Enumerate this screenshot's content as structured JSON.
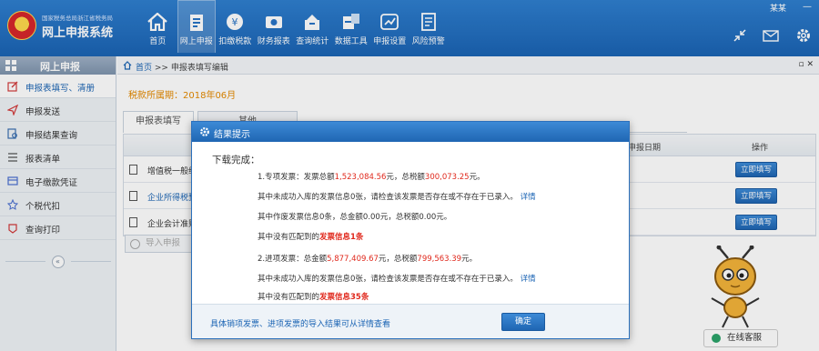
{
  "header": {
    "org_name": "国家税务总局浙江省税务局",
    "system_name": "网上申报系统",
    "user": "某某",
    "nav": [
      {
        "label": "首页",
        "icon": "home-icon"
      },
      {
        "label": "网上申报",
        "icon": "declare-icon"
      },
      {
        "label": "扣缴税款",
        "icon": "tax-payment-icon"
      },
      {
        "label": "财务报表",
        "icon": "report-icon"
      },
      {
        "label": "查询统计",
        "icon": "query-icon"
      },
      {
        "label": "数据工具",
        "icon": "tools-icon"
      },
      {
        "label": "申报设置",
        "icon": "settings-icon"
      },
      {
        "label": "风险预警",
        "icon": "risk-icon"
      }
    ]
  },
  "sidebar": {
    "title": "网上申报",
    "items": [
      {
        "label": "申报表填写、清册"
      },
      {
        "label": "申报发送"
      },
      {
        "label": "申报结果查询"
      },
      {
        "label": "报表清单"
      },
      {
        "label": "电子缴款凭证"
      },
      {
        "label": "个税代扣"
      },
      {
        "label": "查询打印"
      }
    ],
    "collapse": "«"
  },
  "breadcrumb": {
    "home": "首页",
    "separator": ">>",
    "current": "申报表填写编辑"
  },
  "period": "税款所属期：2018年06月",
  "tabs": [
    "申报表填写",
    "其他"
  ],
  "table": {
    "headers": {
      "date": "申报日期",
      "operation": "操作"
    },
    "rows": [
      {
        "name": "增值税一般纳税人",
        "link": false,
        "action": "立即填写"
      },
      {
        "name": "企业所得税预缴",
        "link": true,
        "action": "立即填写"
      },
      {
        "name": "企业会计准则报表",
        "link": false,
        "action": "立即填写"
      }
    ]
  },
  "import_button": "导入申报",
  "online_service": "在线客服",
  "modal": {
    "title": "结果提示",
    "heading": "下载完成：",
    "line1_prefix": "1.专项发票：发票总额",
    "line1_amount": "1,523,084.56",
    "line1_mid": "元，总税额",
    "line1_tax": "300,073.25",
    "line1_suffix": "元。",
    "line2_text": "其中未成功入库的发票信息0张，请检查该发票是否存在或不存在于已录入。",
    "line2_link": "详情",
    "line3": "其中作废发票信息0条，总金额0.00元，总税额0.00元。",
    "line4_prefix": "其中没有匹配到的",
    "line4_red": "发票信息1条",
    "line5_prefix": "2.进项发票：总金额",
    "line5_amount": "5,877,409.67",
    "line5_mid": "元，总税额",
    "line5_tax": "799,563.39",
    "line5_suffix": "元。",
    "line6_text": "其中未成功入库的发票信息0张，请检查该发票是否存在或不存在于已录入。",
    "line6_link": "详情",
    "line7_prefix": "其中没有匹配到的",
    "line7_red": "发票信息35条",
    "footer_tip": "具体销项发票、进项发票的导入结果可从详情查看",
    "ok_label": "确定"
  },
  "colors": {
    "brand": "#1b64b4",
    "highlight_red": "#e0281c",
    "period_orange": "#e58a00"
  }
}
